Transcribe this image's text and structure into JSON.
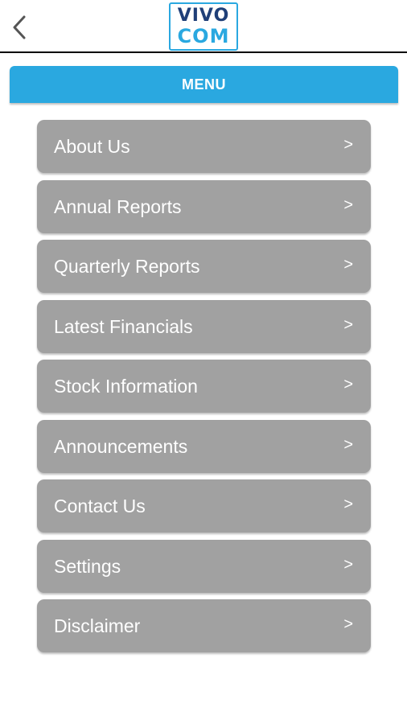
{
  "header": {
    "back_icon": "chevron-left-icon",
    "logo_top": "VIVO",
    "logo_bottom": "COM"
  },
  "menu": {
    "title": "MENU",
    "items": [
      {
        "label": "About Us",
        "chevron": ">"
      },
      {
        "label": "Annual Reports",
        "chevron": ">"
      },
      {
        "label": "Quarterly Reports",
        "chevron": ">"
      },
      {
        "label": "Latest Financials",
        "chevron": ">"
      },
      {
        "label": "Stock Information",
        "chevron": ">"
      },
      {
        "label": "Announcements",
        "chevron": ">"
      },
      {
        "label": "Contact Us",
        "chevron": ">"
      },
      {
        "label": "Settings",
        "chevron": ">"
      },
      {
        "label": "Disclaimer",
        "chevron": ">"
      }
    ]
  },
  "colors": {
    "accent": "#2aa8e0",
    "logo_dark": "#1f3f78",
    "item_background": "#a1a1a1",
    "item_text": "#ffffff"
  }
}
